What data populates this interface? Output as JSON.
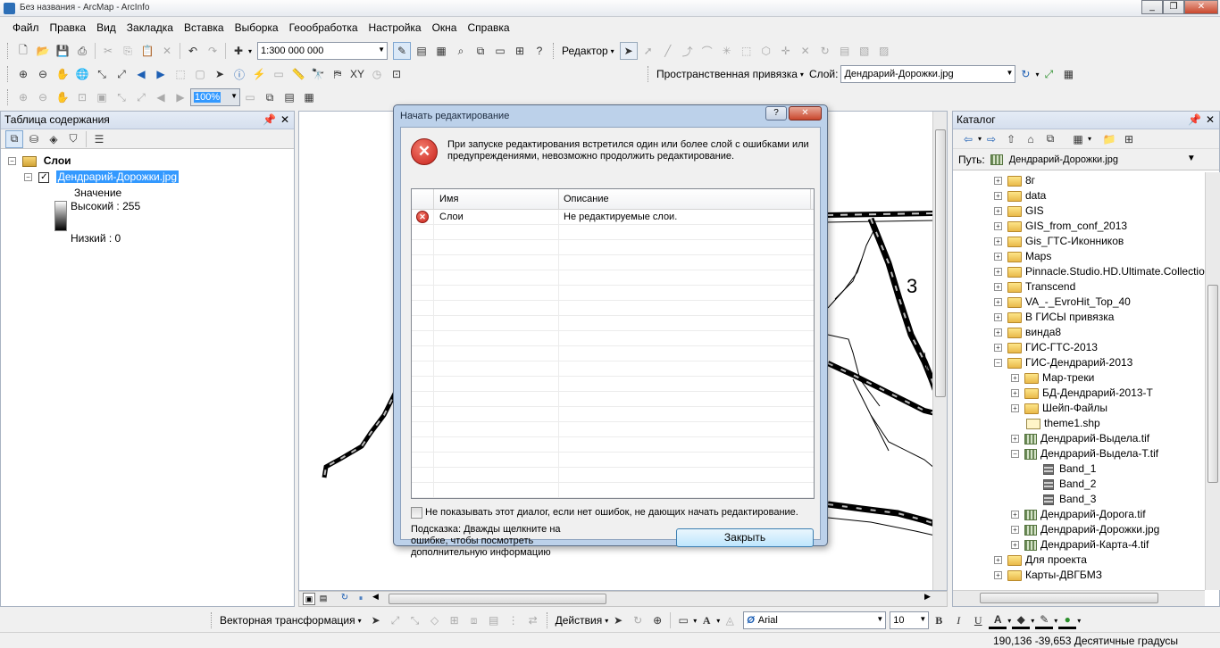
{
  "window": {
    "title": "Без названия - ArcMap - ArcInfo",
    "min": "_",
    "max": "❐",
    "close": "✕"
  },
  "menu": [
    "Файл",
    "Правка",
    "Вид",
    "Закладка",
    "Вставка",
    "Выборка",
    "Геообработка",
    "Настройка",
    "Окна",
    "Справка"
  ],
  "toolbar1": {
    "scale": "1:300 000 000",
    "editor_label": "Редактор"
  },
  "toolbar2": {
    "spatial_label": "Пространственная привязка",
    "layer_label": "Слой:",
    "layer_value": "Дендрарий-Дорожки.jpg"
  },
  "toolbar3": {
    "zoom_value": "100%"
  },
  "toc": {
    "title": "Таблица содержания",
    "layers_group": "Слои",
    "layer_name": "Дендрарий-Дорожки.jpg",
    "value_label": "Значение",
    "high_label": "Высокий : 255",
    "low_label": "Низкий : 0"
  },
  "catalog": {
    "title": "Каталог",
    "path_label": "Путь:",
    "path_value": "Дендрарий-Дорожки.jpg",
    "items": [
      {
        "name": "8г",
        "type": "folder",
        "level": 0,
        "exp": "+"
      },
      {
        "name": "data",
        "type": "folder",
        "level": 0,
        "exp": "+"
      },
      {
        "name": "GIS",
        "type": "folder",
        "level": 0,
        "exp": "+"
      },
      {
        "name": "GIS_from_conf_2013",
        "type": "folder",
        "level": 0,
        "exp": "+"
      },
      {
        "name": "Gis_ГТС-Иконников",
        "type": "folder",
        "level": 0,
        "exp": "+"
      },
      {
        "name": "Maps",
        "type": "folder",
        "level": 0,
        "exp": "+"
      },
      {
        "name": "Pinnacle.Studio.HD.Ultimate.Collectio",
        "type": "folder",
        "level": 0,
        "exp": "+"
      },
      {
        "name": "Transcend",
        "type": "folder",
        "level": 0,
        "exp": "+"
      },
      {
        "name": "VA_-_EvroHit_Top_40",
        "type": "folder",
        "level": 0,
        "exp": "+"
      },
      {
        "name": "В ГИСЫ привязка",
        "type": "folder",
        "level": 0,
        "exp": "+"
      },
      {
        "name": "винда8",
        "type": "folder",
        "level": 0,
        "exp": "+"
      },
      {
        "name": "ГИС-ГТС-2013",
        "type": "folder",
        "level": 0,
        "exp": "+"
      },
      {
        "name": "ГИС-Дендрарий-2013",
        "type": "folder",
        "level": 0,
        "exp": "−"
      },
      {
        "name": "Мар-треки",
        "type": "folder",
        "level": 1,
        "exp": "+"
      },
      {
        "name": "БД-Дендрарий-2013-Т",
        "type": "folder",
        "level": 1,
        "exp": "+"
      },
      {
        "name": "Шейп-Файлы",
        "type": "folder",
        "level": 1,
        "exp": "+"
      },
      {
        "name": "theme1.shp",
        "type": "shp",
        "level": 1,
        "exp": ""
      },
      {
        "name": "Дендрарий-Выдела.tif",
        "type": "raster",
        "level": 1,
        "exp": "+"
      },
      {
        "name": "Дендрарий-Выдела-Т.tif",
        "type": "raster",
        "level": 1,
        "exp": "−"
      },
      {
        "name": "Band_1",
        "type": "band",
        "level": 2,
        "exp": ""
      },
      {
        "name": "Band_2",
        "type": "band",
        "level": 2,
        "exp": ""
      },
      {
        "name": "Band_3",
        "type": "band",
        "level": 2,
        "exp": ""
      },
      {
        "name": "Дендрарий-Дорога.tif",
        "type": "raster",
        "level": 1,
        "exp": "+"
      },
      {
        "name": "Дендрарий-Дорожки.jpg",
        "type": "raster",
        "level": 1,
        "exp": "+"
      },
      {
        "name": "Дендрарий-Карта-4.tif",
        "type": "raster",
        "level": 1,
        "exp": "+"
      },
      {
        "name": "Для проекта",
        "type": "folder",
        "level": 0,
        "exp": "+"
      },
      {
        "name": "Карты-ДВГБМЗ",
        "type": "folder",
        "level": 0,
        "exp": "+"
      }
    ]
  },
  "map": {
    "label_3": "3"
  },
  "dialog": {
    "title": "Начать редактирование",
    "help_btn": "?",
    "close_x": "✕",
    "message": "При запуске редактирования встретился один или более слой с ошибками или предупреждениями, невозможно продолжить редактирование.",
    "col_name": "Имя",
    "col_desc": "Описание",
    "row_name": "Слои",
    "row_desc": "Не редактируемые слои.",
    "checkbox_label": "Не показывать этот диалог, если нет ошибок, не дающих начать редактирование.",
    "hint": "Подсказка: Дважды щелкните на ошибке, чтобы посмотреть дополнительную информацию",
    "close_button": "Закрыть"
  },
  "bottom_toolbar": {
    "transform_label": "Векторная трансформация",
    "actions_label": "Действия",
    "font": "Arial",
    "font_size": "10",
    "bold": "B",
    "italic": "I",
    "underline": "U"
  },
  "status": {
    "coords": "190,136  -39,653 Десятичные градусы"
  }
}
